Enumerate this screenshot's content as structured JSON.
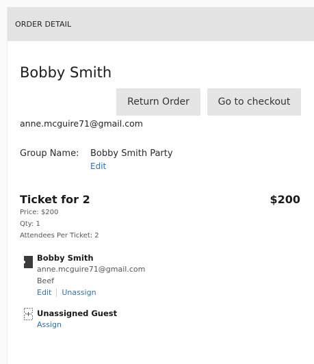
{
  "header": {
    "title": "ORDER DETAIL"
  },
  "customer": {
    "name": "Bobby Smith",
    "email": "anne.mcguire71@gmail.com"
  },
  "actions": {
    "return_label": "Return Order",
    "checkout_label": "Go to checkout"
  },
  "group": {
    "label": "Group Name:",
    "value": "Bobby Smith Party",
    "edit_label": "Edit"
  },
  "ticket": {
    "title": "Ticket for 2",
    "total": "$200",
    "price": "Price: $200",
    "qty": "Qty: 1",
    "attendees_per_ticket": "Attendees Per Ticket: 2"
  },
  "attendees": [
    {
      "icon": "ticket-icon",
      "name": "Bobby Smith",
      "email": "anne.mcguire71@gmail.com",
      "meal": "Beef",
      "edit_label": "Edit",
      "unassign_label": "Unassign"
    },
    {
      "icon": "add-guest-icon",
      "name": "Unassigned Guest",
      "assign_label": "Assign"
    }
  ],
  "colors": {
    "link": "#2f6fb6",
    "header_bg": "#e3e3e3",
    "button_bg": "#e5e5e5"
  }
}
